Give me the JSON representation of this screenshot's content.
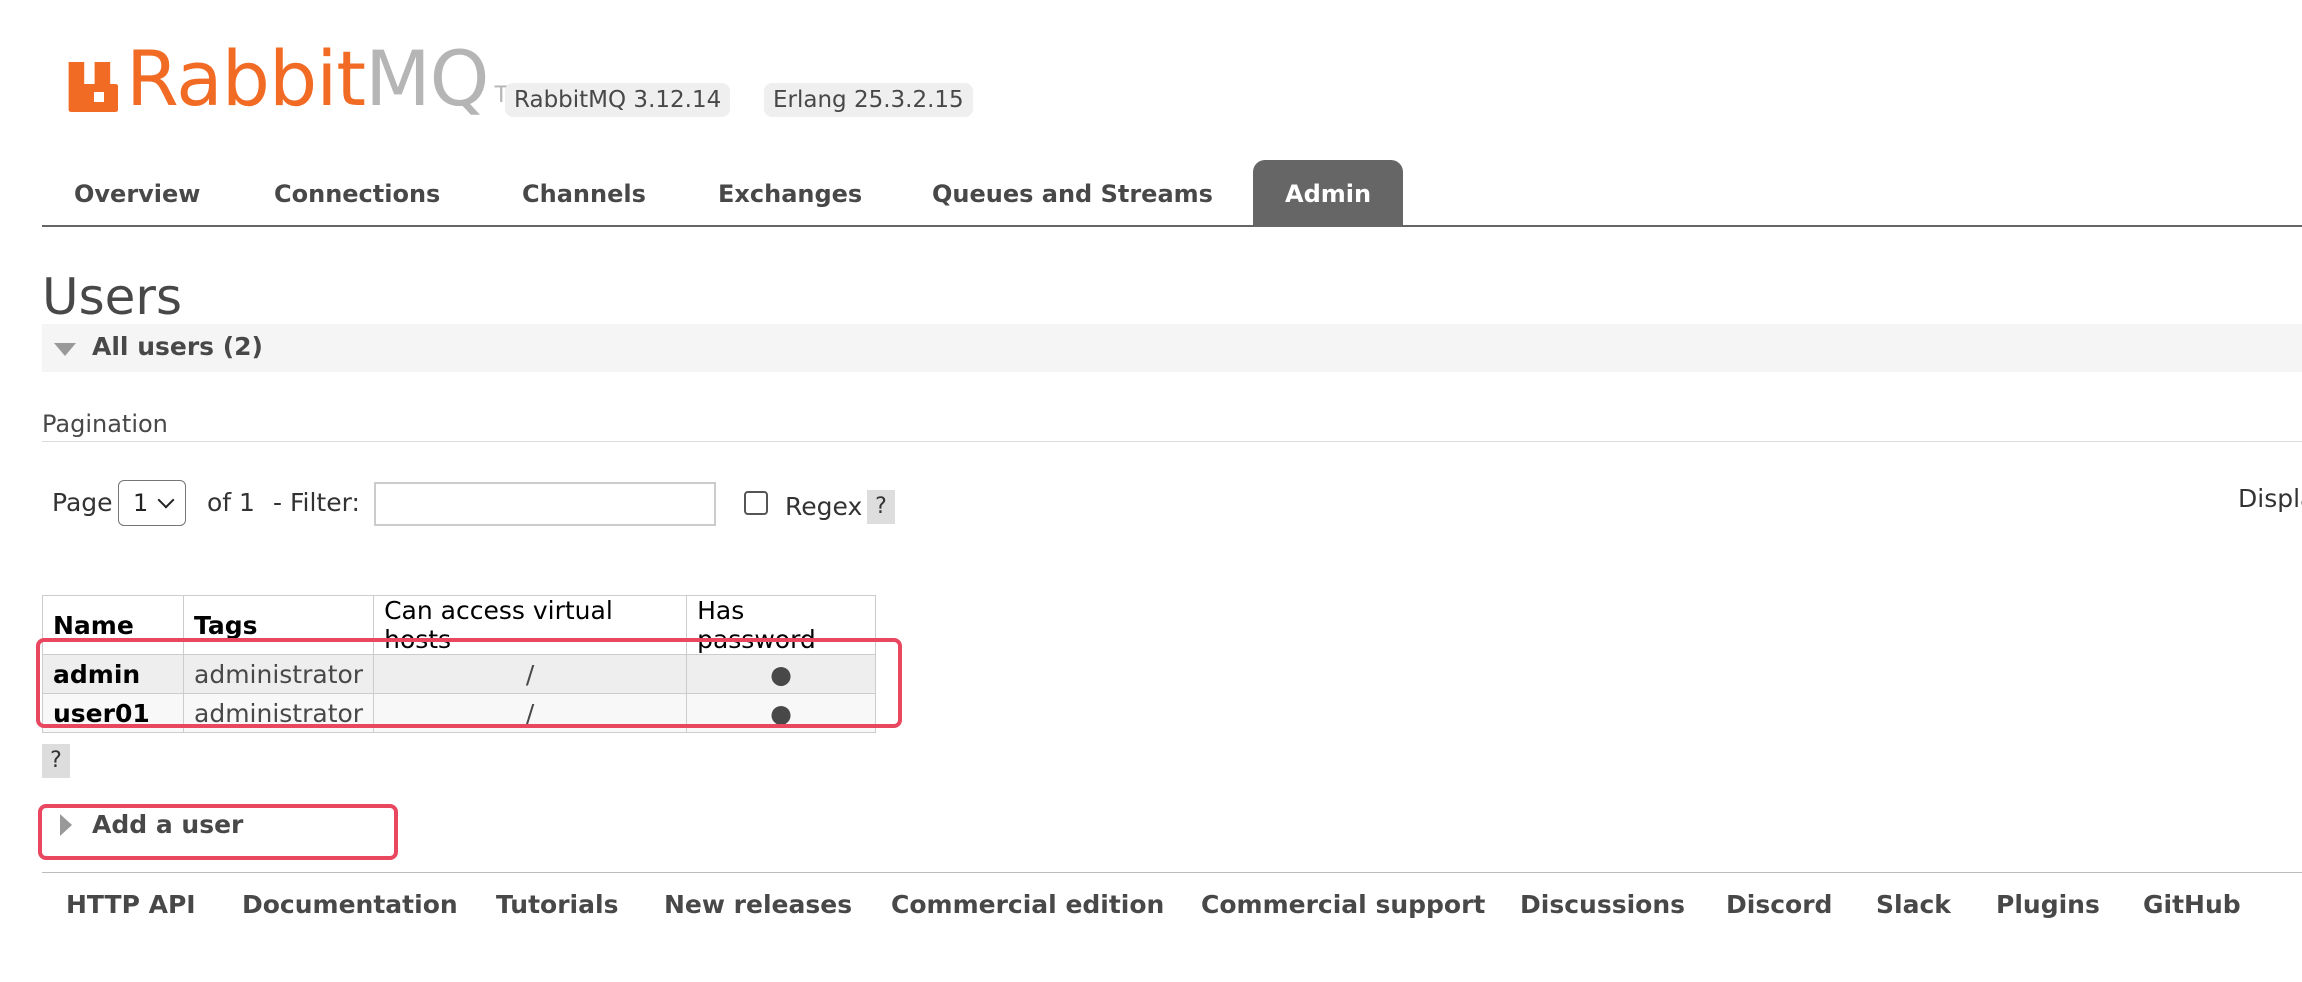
{
  "brand": {
    "logo_rabbit": "Rabbit",
    "logo_mq": "MQ",
    "logo_tm": "TM",
    "version_rabbitmq": "RabbitMQ 3.12.14",
    "version_erlang": "Erlang 25.3.2.15",
    "accent_color": "#f26b25"
  },
  "nav": {
    "tabs": [
      {
        "label": "Overview"
      },
      {
        "label": "Connections"
      },
      {
        "label": "Channels"
      },
      {
        "label": "Exchanges"
      },
      {
        "label": "Queues and Streams"
      },
      {
        "label": "Admin",
        "active": true
      }
    ]
  },
  "page": {
    "title": "Users",
    "section_label": "All users (2)",
    "pagination_title": "Pagination",
    "page_label": "Page",
    "page_value": "1",
    "of_label": "of 1",
    "filter_label": "- Filter:",
    "filter_value": "",
    "regex_label": "Regex",
    "help_label": "?",
    "display_label": "Displa",
    "add_user_label": "Add a user"
  },
  "table": {
    "headers": [
      "Name",
      "Tags",
      "Can access virtual hosts",
      "Has password"
    ],
    "rows": [
      {
        "name": "admin",
        "tags": "administrator",
        "vhosts": "/",
        "has_password": "●"
      },
      {
        "name": "user01",
        "tags": "administrator",
        "vhosts": "/",
        "has_password": "●"
      }
    ]
  },
  "footer": {
    "links": [
      "HTTP API",
      "Documentation",
      "Tutorials",
      "New releases",
      "Commercial edition",
      "Commercial support",
      "Discussions",
      "Discord",
      "Slack",
      "Plugins",
      "GitHub"
    ]
  }
}
